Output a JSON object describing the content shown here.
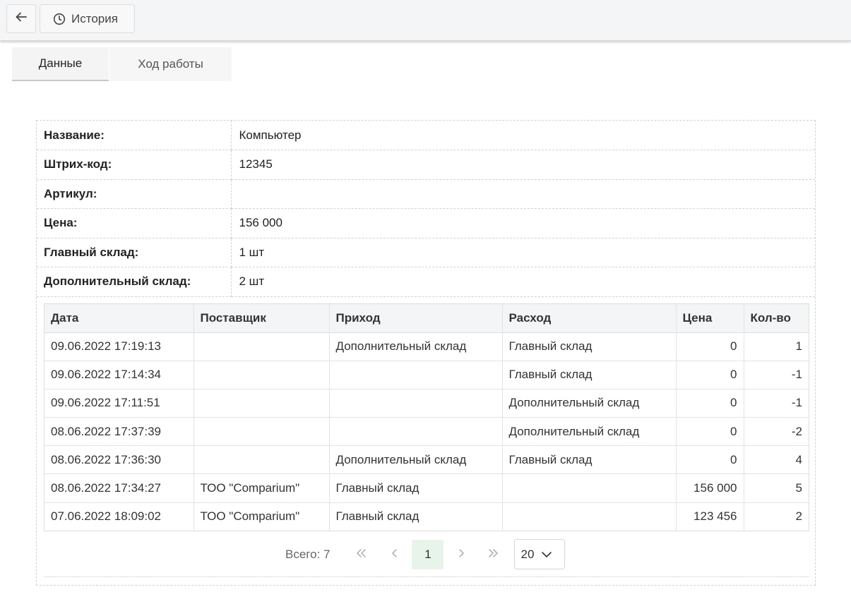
{
  "toolbar": {
    "back_icon": "arrow-left-icon",
    "history_icon": "clock-icon",
    "history_label": "История"
  },
  "tabs": [
    {
      "label": "Данные",
      "active": true
    },
    {
      "label": "Ход работы",
      "active": false
    }
  ],
  "details": [
    {
      "label": "Название:",
      "value": "Компьютер"
    },
    {
      "label": "Штрих-код:",
      "value": "12345"
    },
    {
      "label": "Артикул:",
      "value": ""
    },
    {
      "label": "Цена:",
      "value": "156 000"
    },
    {
      "label": "Главный склад:",
      "value": "1 шт"
    },
    {
      "label": "Дополнительный склад:",
      "value": "2 шт"
    }
  ],
  "table": {
    "columns": [
      "Дата",
      "Поставщик",
      "Приход",
      "Расход",
      "Цена",
      "Кол-во"
    ],
    "rows": [
      [
        "09.06.2022 17:19:13",
        "",
        "Дополнительный склад",
        "Главный склад",
        "0",
        "1"
      ],
      [
        "09.06.2022 17:14:34",
        "",
        "",
        "Главный склад",
        "0",
        "-1"
      ],
      [
        "09.06.2022 17:11:51",
        "",
        "",
        "Дополнительный склад",
        "0",
        "-1"
      ],
      [
        "08.06.2022 17:37:39",
        "",
        "",
        "Дополнительный склад",
        "0",
        "-2"
      ],
      [
        "08.06.2022 17:36:30",
        "",
        "Дополнительный склад",
        "Главный склад",
        "0",
        "4"
      ],
      [
        "08.06.2022 17:34:27",
        "ТОО \"Comparium\"",
        "Главный склад",
        "",
        "156 000",
        "5"
      ],
      [
        "07.06.2022 18:09:02",
        "ТОО \"Comparium\"",
        "Главный склад",
        "",
        "123 456",
        "2"
      ]
    ]
  },
  "pagination": {
    "total_label": "Всего: 7",
    "first_icon": "double-chevron-left-icon",
    "prev_icon": "chevron-left-icon",
    "current_page": "1",
    "next_icon": "chevron-right-icon",
    "last_icon": "double-chevron-right-icon",
    "page_size": "20",
    "page_size_icon": "chevron-down-icon"
  }
}
